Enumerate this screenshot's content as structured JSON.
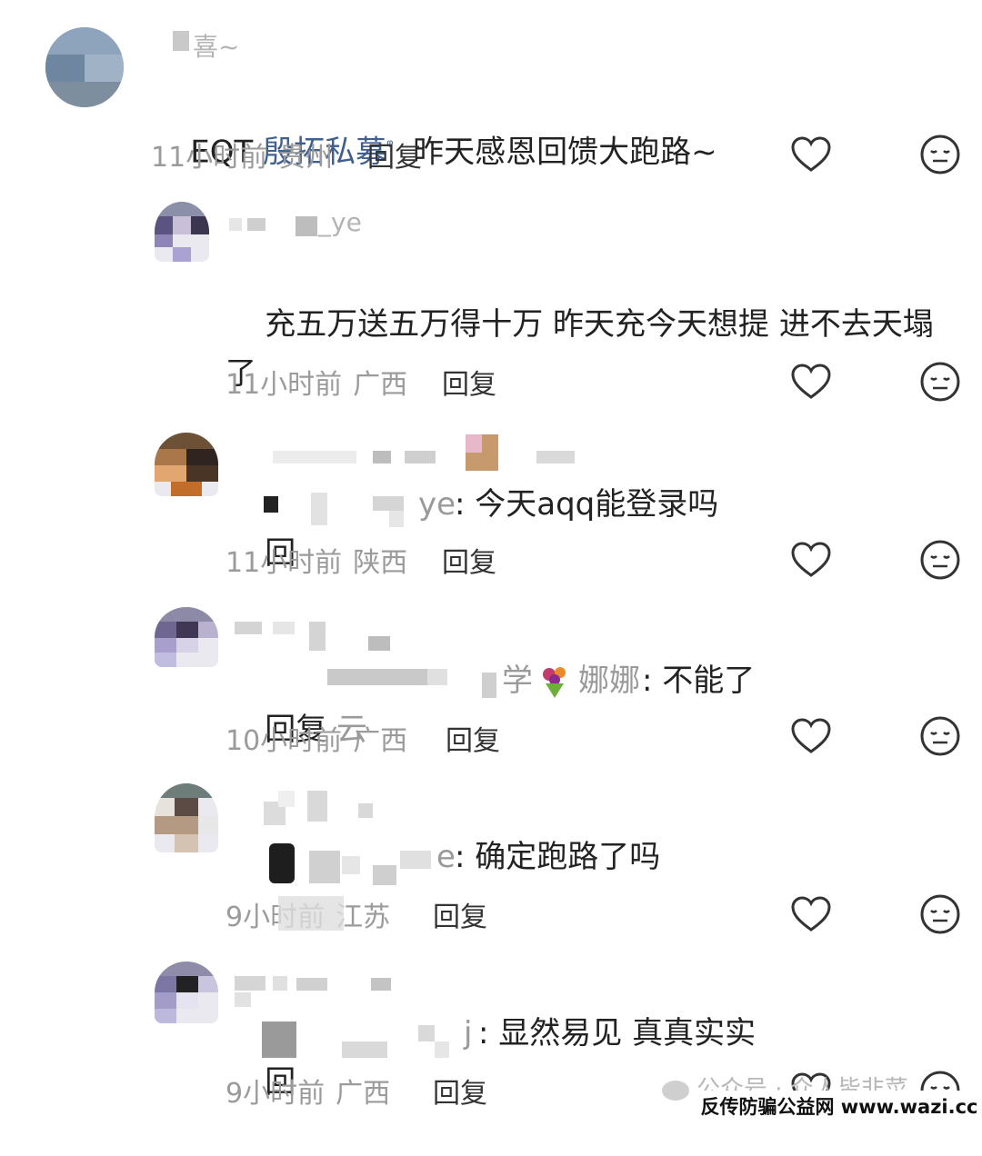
{
  "comments": [
    {
      "username_visible": "喜~",
      "body": {
        "prefix": "EQT ",
        "link": "殷拓私募",
        "link_icon": "search-icon",
        "text": "  昨天感恩回馈大跑路~"
      },
      "time": "11小时前",
      "location": "贵州",
      "reply_label": "回复"
    },
    {
      "username_visible": "_ye",
      "body": {
        "text": "充五万送五万得十万 昨天充今天想提 进不去天塌了"
      },
      "time": "11小时前",
      "location": "广西",
      "reply_label": "回复"
    },
    {
      "username_visible": "",
      "body": {
        "prefix": "回",
        "name_tail": "ye",
        "text": ": 今天aqq能登录吗"
      },
      "time": "11小时前",
      "location": "陕西",
      "reply_label": "回复"
    },
    {
      "username_visible": "",
      "body": {
        "prefix": "回复 ",
        "name_partial": "云",
        "name_mid": "学",
        "name_tail": "娜娜",
        "text": ": 不能了"
      },
      "time": "10小时前",
      "location": "广西",
      "reply_label": "回复"
    },
    {
      "username_visible": "",
      "body": {
        "prefix": "回复",
        "name_tail": "e",
        "text": ": 确定跑路了吗"
      },
      "time": "9小时前",
      "location": "江苏",
      "reply_label": "回复"
    },
    {
      "username_visible": "",
      "body": {
        "prefix": "回",
        "name_tail": "j",
        "text": ": 显然易见 真真实实"
      },
      "time": "9小时前",
      "location": "广西",
      "reply_label": "回复"
    }
  ],
  "icons": {
    "like": "heart-icon",
    "dislike": "meh-face-icon"
  },
  "colors": {
    "link_blue": "#3f5f8e",
    "meta_grey": "#9b9b9b",
    "text": "#222222"
  },
  "watermark": {
    "wechat_text": "公众号 · 众人皆非菜",
    "banner_text": "反传防骗公益网 www.wazi.cc"
  }
}
